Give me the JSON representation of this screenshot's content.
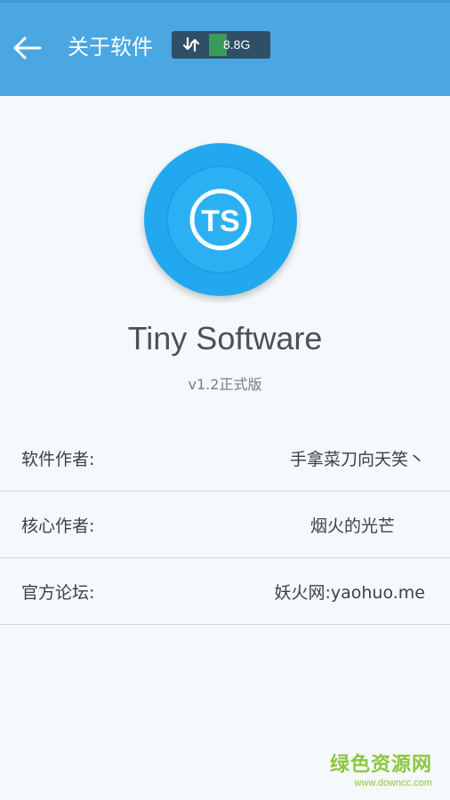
{
  "header": {
    "title": "关于软件",
    "storage_value": "8.8G",
    "storage_fill_fraction": 0.29,
    "accent_color": "#4aa7e1",
    "icons": {
      "back": "arrow-left-icon",
      "sync": "sync-icon"
    }
  },
  "app": {
    "logo_text": "TS",
    "logo_color": "#22a8ef",
    "name": "Tiny Software",
    "version": "v1.2正式版"
  },
  "info": [
    {
      "label": "软件作者:",
      "value": "手拿菜刀向天笑丶"
    },
    {
      "label": "核心作者:",
      "value": "烟火的光芒"
    },
    {
      "label": "官方论坛:",
      "value": "妖火网:yaohuo.me"
    }
  ],
  "watermark": {
    "text": "绿色资源网",
    "url": "www.downcc.com"
  }
}
